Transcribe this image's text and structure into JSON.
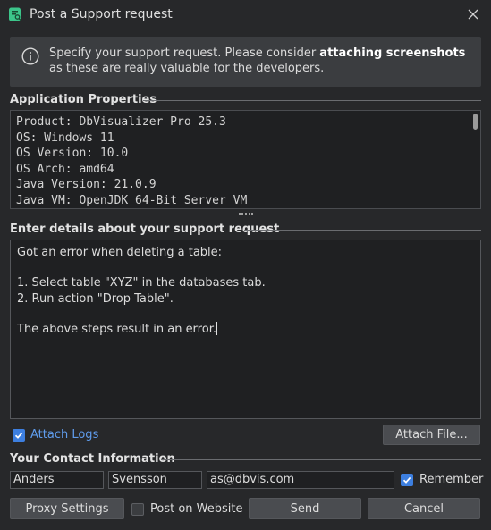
{
  "window": {
    "title": "Post a Support request",
    "app_icon": "dbvisualizer-app-icon",
    "close_icon": "close-icon"
  },
  "info": {
    "text_before": "Specify your support request. Please consider ",
    "text_bold": "attaching screenshots",
    "text_after": " as these are really valuable for the developers."
  },
  "app_properties": {
    "title": "Application Properties",
    "lines": [
      "Product: DbVisualizer Pro 25.3",
      "OS: Windows 11",
      "OS Version: 10.0",
      "OS Arch: amd64",
      "Java Version: 21.0.9",
      "Java VM: OpenJDK 64-Bit Server VM"
    ]
  },
  "details": {
    "title": "Enter details about your support request",
    "lines": [
      "Got an error when deleting a table:",
      "",
      "1. Select table \"XYZ\" in the databases tab.",
      "2. Run action \"Drop Table\".",
      "",
      "The above steps result in an error."
    ]
  },
  "attach": {
    "logs_label": "Attach Logs",
    "logs_checked": true,
    "file_button": "Attach File..."
  },
  "contact": {
    "title": "Your Contact Information",
    "first_name": "Anders",
    "last_name": "Svensson",
    "email": "as@dbvis.com",
    "remember_label": "Remember",
    "remember_checked": true
  },
  "footer": {
    "proxy_button": "Proxy Settings",
    "post_on_website_label": "Post on Website",
    "post_on_website_checked": false,
    "send_button": "Send",
    "cancel_button": "Cancel"
  },
  "colors": {
    "background": "#27282a",
    "panel": "#3b3d40",
    "accent": "#3d7fe0",
    "link": "#5f9cec",
    "app_icon_green": "#3cc58a"
  }
}
